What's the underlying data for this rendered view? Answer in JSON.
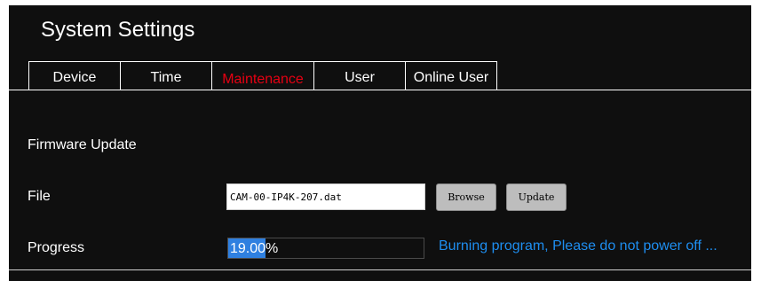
{
  "window": {
    "title": "System Settings"
  },
  "tabs": [
    {
      "label": "Device",
      "active": false
    },
    {
      "label": "Time",
      "active": false
    },
    {
      "label": "Maintenance",
      "active": true
    },
    {
      "label": "User",
      "active": false
    },
    {
      "label": "Online User",
      "active": false
    }
  ],
  "firmware": {
    "section_label": "Firmware Update",
    "file_label": "File",
    "file_value": "CAM-00-IP4K-207.dat",
    "browse_label": "Browse",
    "update_label": "Update",
    "progress_label": "Progress",
    "progress_text": "19.00%",
    "progress_fraction": 0.19,
    "status_message": "Burning program, Please do not power off ..."
  },
  "colors": {
    "background": "#0f0f0f",
    "active_tab_text": "#e60012",
    "progress_fill": "#2f80e0",
    "status_text": "#1e8ef0",
    "button_bg": "#bdbdbd"
  }
}
